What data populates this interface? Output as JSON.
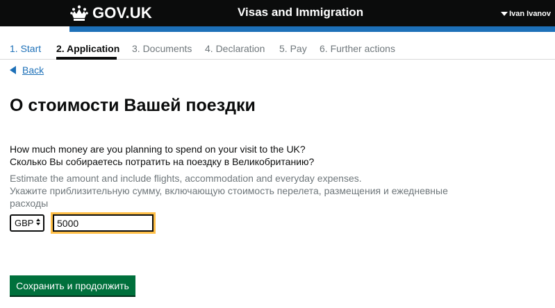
{
  "header": {
    "logo_text": "GOV.UK",
    "logo_icon": "crown-icon",
    "service_name": "Visas and Immigration",
    "user_name": "Ivan Ivanov",
    "brand_color": "#0b0c0c",
    "accent_color": "#1d70b8"
  },
  "steps": [
    {
      "label": "1. Start",
      "state": "done"
    },
    {
      "label": "2. Application",
      "state": "current"
    },
    {
      "label": "3. Documents",
      "state": "upcoming"
    },
    {
      "label": "4. Declaration",
      "state": "upcoming"
    },
    {
      "label": "5. Pay",
      "state": "upcoming"
    },
    {
      "label": "6. Further actions",
      "state": "upcoming"
    }
  ],
  "back_link": "Back",
  "page_title": "О стоимости Вашей поездки",
  "question": {
    "en": "How much money are you planning to spend on your visit to the UK?",
    "ru": "Сколько Вы собираетесь потратить на поездку в Великобританию?"
  },
  "hint": {
    "en": "Estimate the amount and include flights, accommodation and everyday expenses.",
    "ru": "Укажите приблизительную сумму, включающую стоимость перелета, размещения и ежедневные расходы"
  },
  "currency": {
    "selected": "GBP"
  },
  "amount": {
    "value": "5000"
  },
  "submit_label": "Сохранить и продолжить",
  "colors": {
    "focus": "#ffbf47",
    "button": "#00703c",
    "link": "#1d70b8"
  }
}
